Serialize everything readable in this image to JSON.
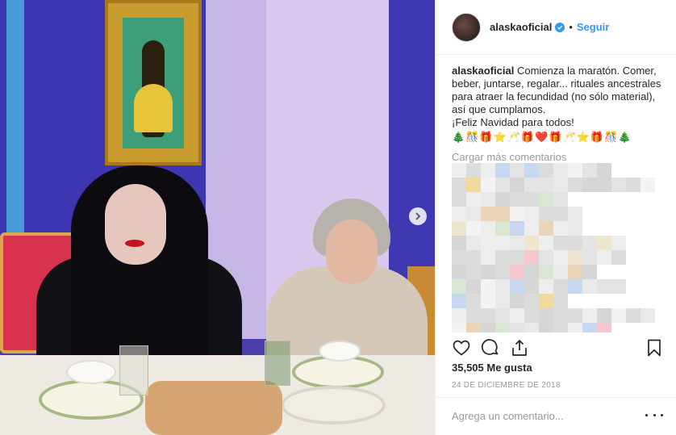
{
  "post": {
    "username": "alaskaoficial",
    "follow_label": "Seguir",
    "dot_separator": "•",
    "caption_user": "alaskaoficial",
    "caption_text": "Comienza la maratón. Comer, beber, juntarse, regalar... rituales ancestrales para atraer la fecundidad (no sólo material), así que cumplamos.",
    "caption_line2": "¡Feliz Navidad para todos!",
    "caption_emojis": "🎄🎊🎁⭐🥂🎁❤️🎁🥂⭐🎁🎊🎄",
    "load_more_label": "Cargar más comentarios",
    "likes_label": "35,505 Me gusta",
    "date_label": "24 DE DICIEMBRE DE 2018",
    "comment_placeholder": "Agrega un comentario..."
  },
  "icons": {
    "verified": "verified-badge-icon",
    "next": "chevron-right-icon",
    "like": "heart-icon",
    "comment": "comment-bubble-icon",
    "share": "share-icon",
    "save": "bookmark-icon",
    "more": "ellipsis-icon"
  },
  "colors": {
    "accent": "#3897f0",
    "text": "#262626",
    "muted": "#999999",
    "border": "#efefef"
  }
}
